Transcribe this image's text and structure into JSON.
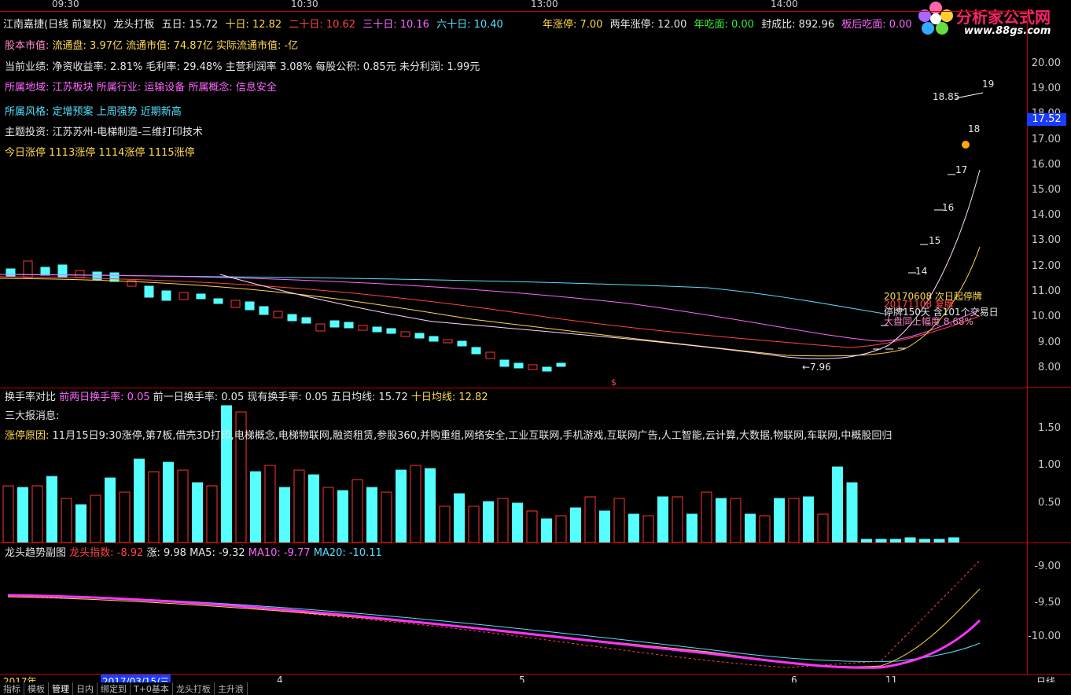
{
  "time_axis": [
    "09:30",
    "10:30",
    "13:00",
    "14:00"
  ],
  "header": {
    "title": "江南嘉捷(日线 前复权)",
    "indicator": "龙头打板",
    "ma5": "五日: 15.72",
    "ma10": "十日: 12.82",
    "ma20": "二十日: 10.62",
    "ma30": "三十日: 10.16",
    "ma60": "六十日: 10.40",
    "year_limit": "年涨停: 7.00",
    "two_year_limit": "两年涨停: 12.00",
    "year_eat": "年吃面: 0.00",
    "seal_ratio": "封成比: 892.96",
    "after_eat": "板后吃面: 0.00"
  },
  "info_lines": {
    "capital": "股本市值:",
    "capital_value": "流通盘: 3.97亿  流通市值: 74.87亿  实际流通市值: -亿",
    "performance_label": "当前业绩:",
    "performance_value": "净资收益率: 2.81% 毛利率: 29.48% 主营利润率 3.08% 每股公积: 0.85元 未分利润: 1.99元",
    "region_label": "所属地域:",
    "region": "江苏板块",
    "industry_label": "所属行业:",
    "industry": "运输设备",
    "concept_label": "所属概念:",
    "concept": "信息安全",
    "style": "所属风格: 定增预案 上周强势 近期新高",
    "theme": "主题投资:    江苏苏州-电梯制造-三维打印技术",
    "limits": "今日涨停 1113涨停 1114涨停 1115涨停"
  },
  "annotations": {
    "low": "←7.96",
    "high": "18.85",
    "high_arrow": "19",
    "n18": "18",
    "n17": "17",
    "n16": "16",
    "n15": "15",
    "n14": "14",
    "note1": "20170608 次日起停牌",
    "note2": "20171108 复牌",
    "note3": "停牌150天 含101个交易日",
    "note4": "大盘同上幅度 8.68%",
    "dollar": "$"
  },
  "price_axis": [
    "20.00",
    "19.00",
    "18.00",
    "17.00",
    "16.00",
    "15.00",
    "14.00",
    "13.00",
    "12.00",
    "11.00",
    "10.00",
    "9.00",
    "8.00"
  ],
  "current_price": "17.52",
  "turnover": {
    "title": "换手率对比",
    "prev2": "前两日换手率: 0.05",
    "prev1": "前一日换手率: 0.05",
    "now": "现有换手率: 0.05",
    "ma5": "五日均线: 15.72",
    "ma10": "十日均线: 12.82",
    "news_title": "三大报消息:",
    "reason_label": "涨停原因:",
    "reason": "11月15日9:30涨停,第7板,借壳3D打印,电梯概念,电梯物联网,融资租赁,参股360,并购重组,网络安全,工业互联网,手机游戏,互联网广告,人工智能,云计算,大数据,物联网,车联网,中概股回归",
    "axis": [
      "1.50",
      "1.00",
      "0.50"
    ]
  },
  "trend": {
    "title": "龙头趋势副图",
    "index": "龙头指数: -8.92",
    "rise": "涨: 9.98",
    "ma5": "MA5: -9.32",
    "ma10": "MA10: -9.77",
    "ma20": "MA20: -10.11",
    "axis": [
      "-9.00",
      "-9.50",
      "-10.00"
    ]
  },
  "date_axis": {
    "year": "2017年",
    "cursor": "2017/03/15/三",
    "m4": "4",
    "m5": "5",
    "m6": "6",
    "m11": "11",
    "period": "日线"
  },
  "tabs": [
    "指标",
    "模板",
    "管理",
    "日内",
    "绑定到",
    "T+0基本",
    "龙头打板",
    "主升浪"
  ],
  "logo": {
    "name": "分析家公式网",
    "url": "www.88gs.com"
  },
  "colors": {
    "up": "#ff3333",
    "down": "#55ffff",
    "grid": "#c00000"
  }
}
